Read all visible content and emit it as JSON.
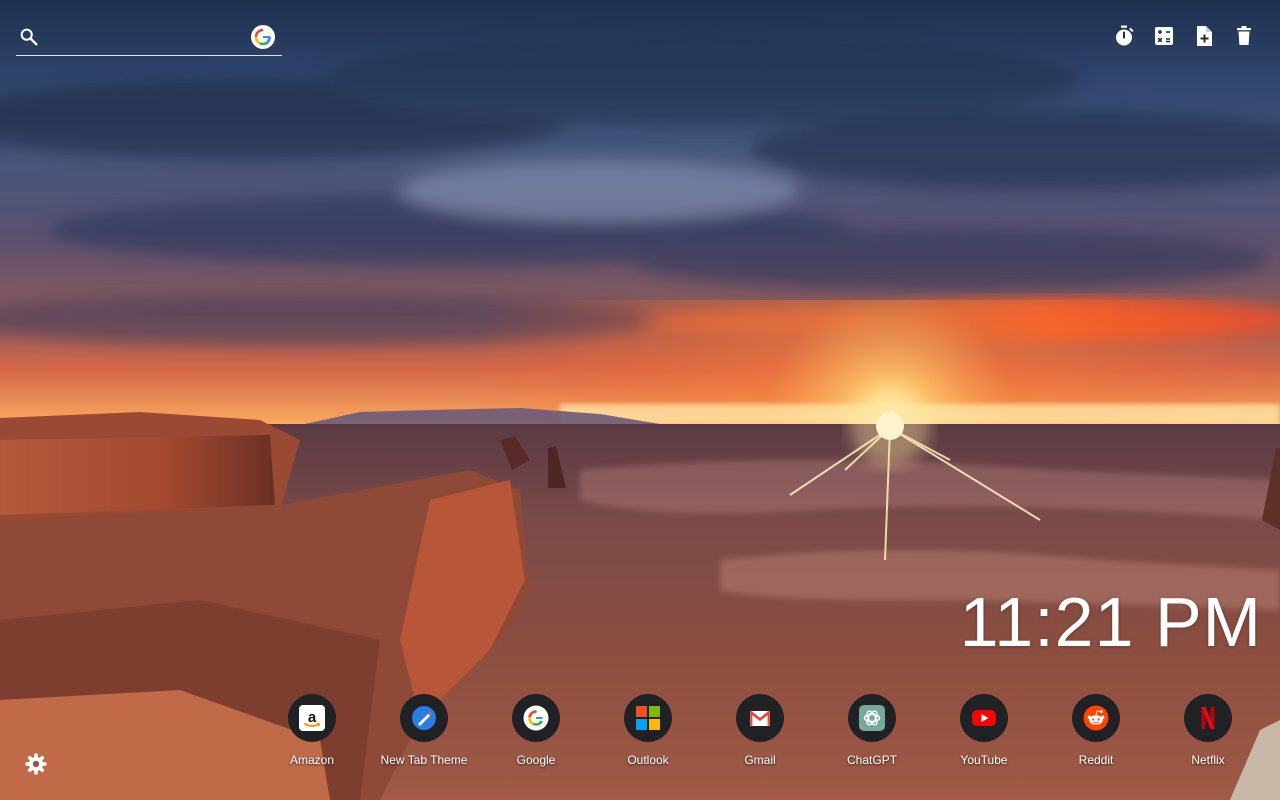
{
  "search": {
    "placeholder": "",
    "value": "",
    "engine_icon": "google-g-icon"
  },
  "toolbar": [
    {
      "name": "timer-button",
      "icon": "timer-icon"
    },
    {
      "name": "calculator-button",
      "icon": "calculator-icon"
    },
    {
      "name": "new-note-button",
      "icon": "note-add-icon"
    },
    {
      "name": "delete-button",
      "icon": "trash-icon"
    }
  ],
  "clock": {
    "time": "11:21 PM"
  },
  "shortcuts": [
    {
      "label": "Amazon",
      "icon": "amazon-icon"
    },
    {
      "label": "New Tab Theme",
      "icon": "new-tab-theme-icon"
    },
    {
      "label": "Google",
      "icon": "google-icon"
    },
    {
      "label": "Outlook",
      "icon": "outlook-icon"
    },
    {
      "label": "Gmail",
      "icon": "gmail-icon"
    },
    {
      "label": "ChatGPT",
      "icon": "chatgpt-icon"
    },
    {
      "label": "YouTube",
      "icon": "youtube-icon"
    },
    {
      "label": "Reddit",
      "icon": "reddit-icon"
    },
    {
      "label": "Netflix",
      "icon": "netflix-icon"
    }
  ],
  "settings": {
    "icon": "gear-icon"
  },
  "colors": {
    "shortcut_bg": "#1f2124",
    "text": "#ffffff",
    "google_blue": "#4285F4",
    "google_red": "#EA4335",
    "google_yellow": "#FBBC05",
    "google_green": "#34A853",
    "youtube_red": "#FF0000",
    "reddit_orange": "#FF4500",
    "netflix_red": "#E50914"
  }
}
